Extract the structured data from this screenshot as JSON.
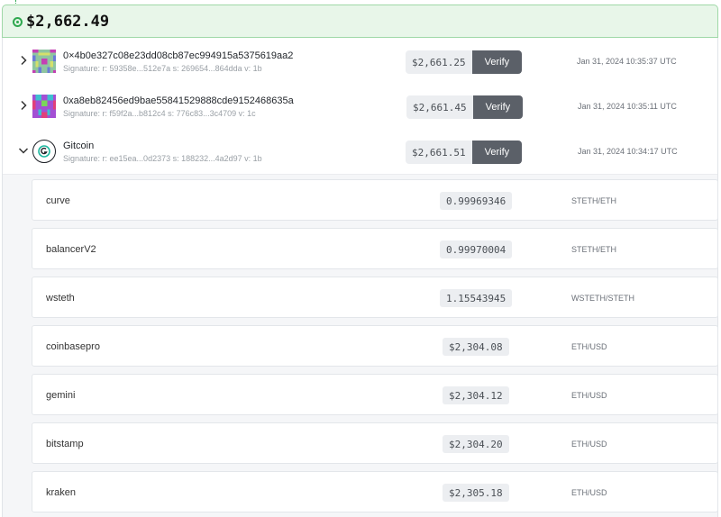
{
  "header": {
    "total": "$2,662.49"
  },
  "signers": [
    {
      "name": "0×4b0e327c08e23dd08cb87ec994915a5375619aa2",
      "signature": "Signature:  r: 59358e...512e7a  s: 269654...864dda  v: 1b",
      "price": "$2,661.25",
      "verify_label": "Verify",
      "timestamp": "Jan 31, 2024 10:35:37 UTC",
      "expanded": false
    },
    {
      "name": "0xa8eb82456ed9bae55841529888cde9152468635a",
      "signature": "Signature:  r: f59f2a...b812c4  s: 776c83...3c4709  v: 1c",
      "price": "$2,661.45",
      "verify_label": "Verify",
      "timestamp": "Jan 31, 2024 10:35:11 UTC",
      "expanded": false
    },
    {
      "name": "Gitcoin",
      "signature": "Signature:  r: ee15ea...0d2373  s: 188232...4a2d97  v: 1b",
      "price": "$2,661.51",
      "verify_label": "Verify",
      "timestamp": "Jan 31, 2024 10:34:17 UTC",
      "expanded": true
    }
  ],
  "sources": [
    {
      "name": "curve",
      "value": "0.99969346",
      "pair": "STETH/ETH"
    },
    {
      "name": "balancerV2",
      "value": "0.99970004",
      "pair": "STETH/ETH"
    },
    {
      "name": "wsteth",
      "value": "1.15543945",
      "pair": "WSTETH/STETH"
    },
    {
      "name": "coinbasepro",
      "value": "$2,304.08",
      "pair": "ETH/USD"
    },
    {
      "name": "gemini",
      "value": "$2,304.12",
      "pair": "ETH/USD"
    },
    {
      "name": "bitstamp",
      "value": "$2,304.20",
      "pair": "ETH/USD"
    },
    {
      "name": "kraken",
      "value": "$2,305.18",
      "pair": "ETH/USD"
    }
  ],
  "icons": {
    "collapsed_chevron": "chevron-right-icon",
    "expanded_chevron": "chevron-down-icon",
    "status": "status-dot-icon",
    "gitcoin": "gitcoin-logo-icon"
  },
  "colors": {
    "accent_green": "#2fa84f",
    "header_bg": "#e8f6e9",
    "verify_bg": "#5b6068"
  }
}
